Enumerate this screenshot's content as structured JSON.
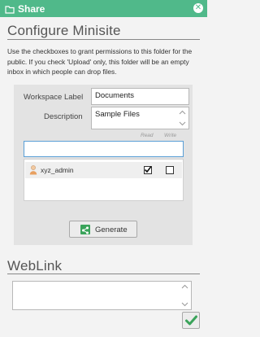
{
  "titlebar": {
    "title": "Share",
    "icon": "folder-icon",
    "close_icon": "close-icon"
  },
  "configure": {
    "heading": "Configure Minisite",
    "description": "Use the checkboxes to grant permissions to this folder for the public. If you check 'Upload' only, this folder will be an empty inbox in which people can drop files."
  },
  "form": {
    "workspace_label": {
      "label": "Workspace Label",
      "value": "Documents"
    },
    "description": {
      "label": "Description",
      "value": "Sample Files"
    }
  },
  "permissions": {
    "columns": {
      "read": "Read",
      "write": "Write"
    },
    "search_value": "",
    "users": [
      {
        "name": "xyz_admin",
        "read": true,
        "write": false,
        "icon": "user-icon"
      }
    ]
  },
  "generate": {
    "label": "Generate",
    "icon": "share-icon"
  },
  "weblink": {
    "heading": "WebLink",
    "value": ""
  },
  "ok": {
    "icon": "checkmark-icon"
  },
  "colors": {
    "accent": "#50b98a",
    "check_green": "#3aa35a",
    "search_border": "#5a9fd6"
  }
}
